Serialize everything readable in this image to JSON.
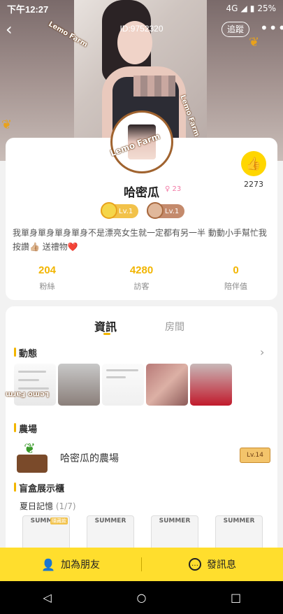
{
  "status_bar": {
    "time": "下午12:27",
    "battery": "25%",
    "network": "4G"
  },
  "header": {
    "uid": "ID:9752320",
    "follow_label": "追蹤",
    "more_label": "•••"
  },
  "profile": {
    "name": "哈密瓜",
    "gender_symbol": "♀",
    "gender_value": "23",
    "likes": "2273",
    "badges": [
      "Lv.1",
      "Lv.1"
    ],
    "bio": "我單身單身單身單身不是漂亮女生就一定都有另一半 動動小手幫忙我按讚👍🏼 送禮物❤️",
    "stats": [
      {
        "value": "204",
        "label": "粉絲"
      },
      {
        "value": "4280",
        "label": "訪客"
      },
      {
        "value": "0",
        "label": "陪伴值"
      }
    ]
  },
  "stickers": [
    "Lemo Farm",
    "Lemo Farm",
    "Lemo Farm",
    "Lemo Farm"
  ],
  "tabs": {
    "info": "資訊",
    "room": "房間"
  },
  "sections": {
    "moments": "動態",
    "farm": "農場",
    "farm_name": "哈密瓜的農場",
    "farm_level": "Lv.14",
    "blindbox": "盲盒展示櫃",
    "blindbox_series": "夏日記憶",
    "blindbox_count": "(1/7)",
    "box_caption": "SUMMER",
    "box_tag": "隱藏款"
  },
  "actions": {
    "add_friend": "加為朋友",
    "message": "發訊息"
  },
  "colors": {
    "accent": "#ffde2d",
    "stat": "#f2b500",
    "brand_brown": "#a0632f"
  }
}
